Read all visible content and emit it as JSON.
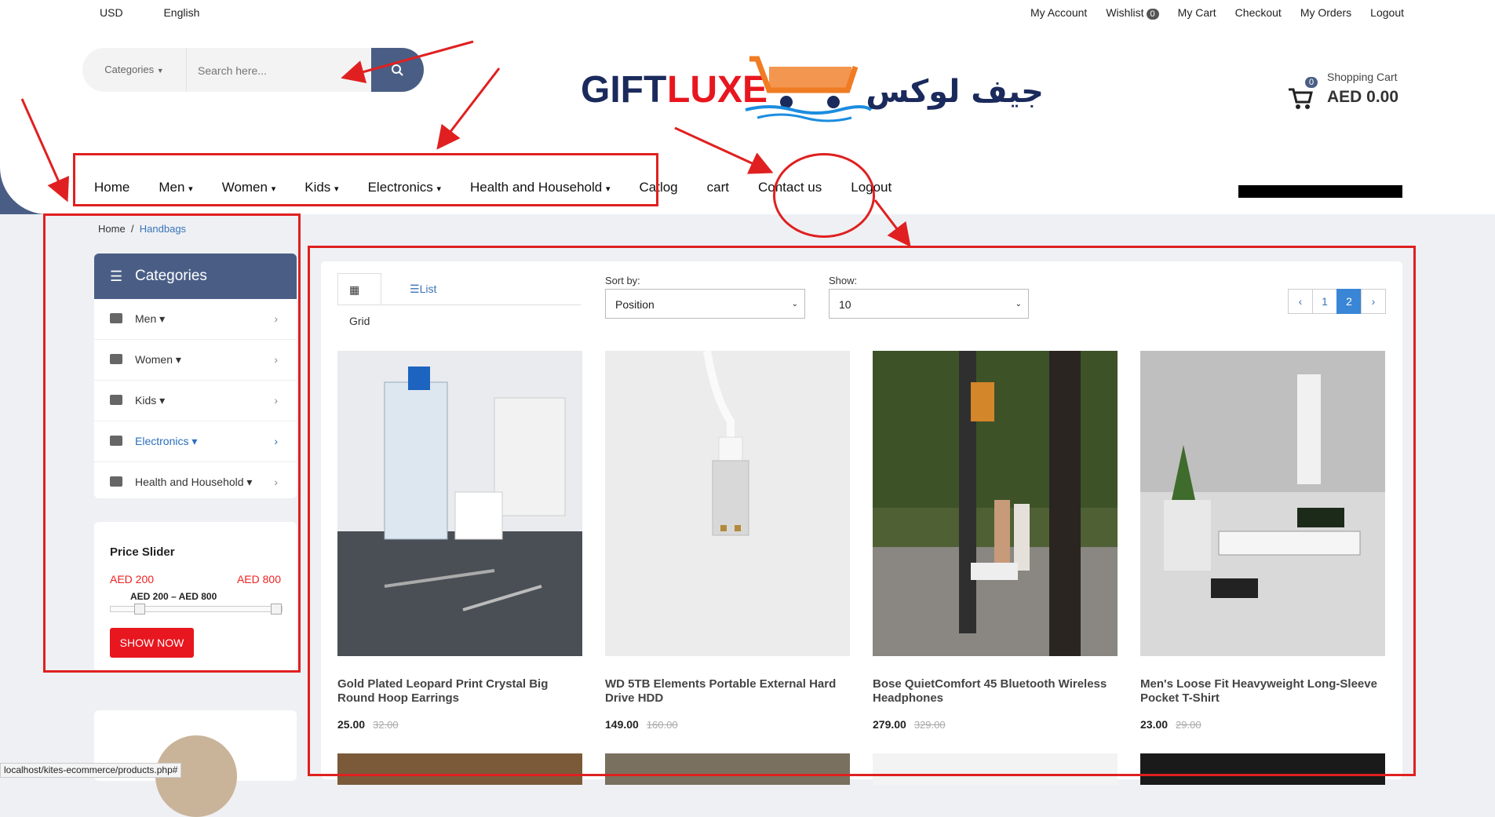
{
  "topbar": {
    "currency": "USD",
    "language": "English",
    "my_account": "My Account",
    "wishlist": "Wishlist",
    "wishlist_count": "0",
    "my_cart": "My Cart",
    "checkout": "Checkout",
    "my_orders": "My Orders",
    "logout": "Logout"
  },
  "search": {
    "category": "Categories",
    "placeholder": "Search here..."
  },
  "logo": {
    "text_en_1": "GIFT",
    "text_en_2": "LUXE",
    "text_ar": "جيف لوكس"
  },
  "cart": {
    "label": "Shopping Cart",
    "total": "AED 0.00",
    "count": "0"
  },
  "nav": {
    "home": "Home",
    "men": "Men",
    "women": "Women",
    "kids": "Kids",
    "electronics": "Electronics",
    "health": "Health and Household",
    "catlog": "Catlog",
    "cart": "cart",
    "contact": "Contact us",
    "logout": "Logout"
  },
  "breadcrumb": {
    "home": "Home",
    "sep": "/",
    "current": "Handbags"
  },
  "categories": {
    "title": "Categories",
    "items": [
      "Men",
      "Women",
      "Kids",
      "Electronics",
      "Health and Household"
    ]
  },
  "price_slider": {
    "title": "Price Slider",
    "min": "AED 200",
    "max": "AED 800",
    "range": "AED 200 – AED 800",
    "button": "SHOW NOW"
  },
  "toolbar": {
    "grid": "Grid",
    "list": "List",
    "sort_label": "Sort by:",
    "sort_value": "Position",
    "show_label": "Show:",
    "show_value": "10",
    "pages": [
      "1",
      "2"
    ],
    "current_page": "2"
  },
  "products": [
    {
      "name": "Gold Plated Leopard Print Crystal Big Round Hoop Earrings",
      "price": "25.00",
      "old_price": "32.00"
    },
    {
      "name": "WD 5TB Elements Portable External Hard Drive HDD",
      "price": "149.00",
      "old_price": "160.00"
    },
    {
      "name": "Bose QuietComfort 45 Bluetooth Wireless Headphones",
      "price": "279.00",
      "old_price": "329.00"
    },
    {
      "name": "Men's Loose Fit Heavyweight Long-Sleeve Pocket T-Shirt",
      "price": "23.00",
      "old_price": "29.00"
    }
  ],
  "status_url": "localhost/kites-ecommerce/products.php#",
  "colors": {
    "accent": "#4a5e85",
    "red": "#e8161e",
    "link": "#3a74b6"
  }
}
